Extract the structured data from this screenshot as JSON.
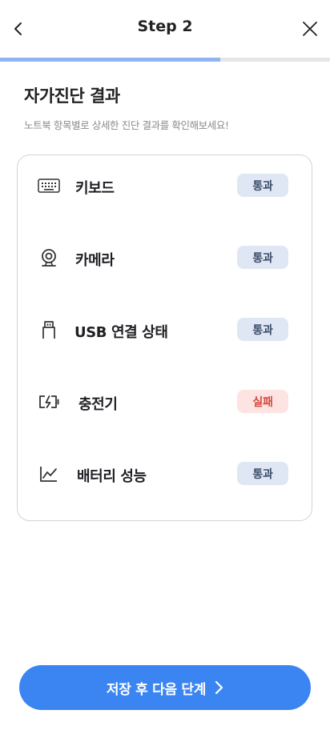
{
  "header": {
    "title": "Step 2",
    "back_icon": "chevron-left-icon",
    "close_icon": "close-icon"
  },
  "progress": {
    "fraction": 0.667,
    "fill_color": "#8fb4f3"
  },
  "main": {
    "title": "자가진단 결과",
    "subtitle": "노트북 항목별로 상세한 진단 결과를 확인해보세요!"
  },
  "results": [
    {
      "label": "키보드",
      "status": "통과",
      "state": "pass",
      "icon": "keyboard-icon"
    },
    {
      "label": "카메라",
      "status": "통과",
      "state": "pass",
      "icon": "webcam-icon"
    },
    {
      "label": "USB 연결 상태",
      "status": "통과",
      "state": "pass",
      "icon": "usb-icon"
    },
    {
      "label": "충전기",
      "status": "실패",
      "state": "fail",
      "icon": "battery-charging-icon"
    },
    {
      "label": "배터리 성능",
      "status": "통과",
      "state": "pass",
      "icon": "chart-line-icon"
    }
  ],
  "cta": {
    "label": "저장 후 다음 단계",
    "icon": "chevron-right-icon",
    "color": "#3a85f2"
  },
  "colors": {
    "pass_bg": "#dfe7f5",
    "pass_text": "#3f4e6b",
    "fail_bg": "#fde3e2",
    "fail_text": "#d34a40"
  }
}
